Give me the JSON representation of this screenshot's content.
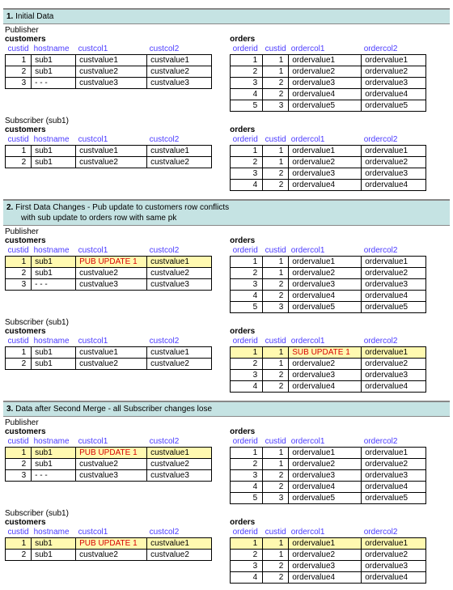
{
  "headers": {
    "s1": {
      "num": "1.",
      "title": "Initial Data",
      "sub": ""
    },
    "s2": {
      "num": "2.",
      "title": "First Data Changes - Pub update to customers row conflicts",
      "sub": "with sub update to orders row with same pk"
    },
    "s3": {
      "num": "3.",
      "title": "Data after Second Merge - all Subscriber changes lose",
      "sub": ""
    }
  },
  "hosts": {
    "pub": "Publisher",
    "sub": "Subscriber (sub1)"
  },
  "tblTitles": {
    "cust": "customers",
    "ord": "orders"
  },
  "custCols": [
    "custid",
    "hostname",
    "custcol1",
    "custcol2"
  ],
  "ordCols": [
    "orderid",
    "custid",
    "ordercol1",
    "ordercol2"
  ],
  "section1": {
    "pub": {
      "cust": [
        {
          "r": [
            "1",
            "sub1",
            "custvalue1",
            "custvalue1"
          ]
        },
        {
          "r": [
            "2",
            "sub1",
            "custvalue2",
            "custvalue2"
          ]
        },
        {
          "r": [
            "3",
            "- - -",
            "custvalue3",
            "custvalue3"
          ]
        }
      ],
      "ord": [
        {
          "r": [
            "1",
            "1",
            "ordervalue1",
            "ordervalue1"
          ]
        },
        {
          "r": [
            "2",
            "1",
            "ordervalue2",
            "ordervalue2"
          ]
        },
        {
          "r": [
            "3",
            "2",
            "ordervalue3",
            "ordervalue3"
          ]
        },
        {
          "r": [
            "4",
            "2",
            "ordervalue4",
            "ordervalue4"
          ]
        },
        {
          "r": [
            "5",
            "3",
            "ordervalue5",
            "ordervalue5"
          ]
        }
      ]
    },
    "sub": {
      "cust": [
        {
          "r": [
            "1",
            "sub1",
            "custvalue1",
            "custvalue1"
          ]
        },
        {
          "r": [
            "2",
            "sub1",
            "custvalue2",
            "custvalue2"
          ]
        }
      ],
      "ord": [
        {
          "r": [
            "1",
            "1",
            "ordervalue1",
            "ordervalue1"
          ]
        },
        {
          "r": [
            "2",
            "1",
            "ordervalue2",
            "ordervalue2"
          ]
        },
        {
          "r": [
            "3",
            "2",
            "ordervalue3",
            "ordervalue3"
          ]
        },
        {
          "r": [
            "4",
            "2",
            "ordervalue4",
            "ordervalue4"
          ]
        }
      ]
    }
  },
  "section2": {
    "pub": {
      "cust": [
        {
          "r": [
            "1",
            "sub1",
            "PUB UPDATE 1",
            "custvalue1"
          ],
          "hl": [
            0,
            1,
            3
          ],
          "upd": [
            2
          ]
        },
        {
          "r": [
            "2",
            "sub1",
            "custvalue2",
            "custvalue2"
          ]
        },
        {
          "r": [
            "3",
            "- - -",
            "custvalue3",
            "custvalue3"
          ]
        }
      ],
      "ord": [
        {
          "r": [
            "1",
            "1",
            "ordervalue1",
            "ordervalue1"
          ]
        },
        {
          "r": [
            "2",
            "1",
            "ordervalue2",
            "ordervalue2"
          ]
        },
        {
          "r": [
            "3",
            "2",
            "ordervalue3",
            "ordervalue3"
          ]
        },
        {
          "r": [
            "4",
            "2",
            "ordervalue4",
            "ordervalue4"
          ]
        },
        {
          "r": [
            "5",
            "3",
            "ordervalue5",
            "ordervalue5"
          ]
        }
      ]
    },
    "sub": {
      "cust": [
        {
          "r": [
            "1",
            "sub1",
            "custvalue1",
            "custvalue1"
          ]
        },
        {
          "r": [
            "2",
            "sub1",
            "custvalue2",
            "custvalue2"
          ]
        }
      ],
      "ord": [
        {
          "r": [
            "1",
            "1",
            "SUB UPDATE 1",
            "ordervalue1"
          ],
          "hl": [
            0,
            1,
            3
          ],
          "upd": [
            2
          ]
        },
        {
          "r": [
            "2",
            "1",
            "ordervalue2",
            "ordervalue2"
          ]
        },
        {
          "r": [
            "3",
            "2",
            "ordervalue3",
            "ordervalue3"
          ]
        },
        {
          "r": [
            "4",
            "2",
            "ordervalue4",
            "ordervalue4"
          ]
        }
      ]
    }
  },
  "section3": {
    "pub": {
      "cust": [
        {
          "r": [
            "1",
            "sub1",
            "PUB UPDATE 1",
            "custvalue1"
          ],
          "hl": [
            0,
            1,
            3
          ],
          "upd": [
            2
          ]
        },
        {
          "r": [
            "2",
            "sub1",
            "custvalue2",
            "custvalue2"
          ]
        },
        {
          "r": [
            "3",
            "- - -",
            "custvalue3",
            "custvalue3"
          ]
        }
      ],
      "ord": [
        {
          "r": [
            "1",
            "1",
            "ordervalue1",
            "ordervalue1"
          ]
        },
        {
          "r": [
            "2",
            "1",
            "ordervalue2",
            "ordervalue2"
          ]
        },
        {
          "r": [
            "3",
            "2",
            "ordervalue3",
            "ordervalue3"
          ]
        },
        {
          "r": [
            "4",
            "2",
            "ordervalue4",
            "ordervalue4"
          ]
        },
        {
          "r": [
            "5",
            "3",
            "ordervalue5",
            "ordervalue5"
          ]
        }
      ]
    },
    "sub": {
      "cust": [
        {
          "r": [
            "1",
            "sub1",
            "PUB UPDATE 1",
            "custvalue1"
          ],
          "hl": [
            0,
            1,
            3
          ],
          "upd": [
            2
          ]
        },
        {
          "r": [
            "2",
            "sub1",
            "custvalue2",
            "custvalue2"
          ]
        }
      ],
      "ord": [
        {
          "r": [
            "1",
            "1",
            "ordervalue1",
            "ordervalue1"
          ],
          "hl": [
            0,
            1,
            2,
            3
          ]
        },
        {
          "r": [
            "2",
            "1",
            "ordervalue2",
            "ordervalue2"
          ]
        },
        {
          "r": [
            "3",
            "2",
            "ordervalue3",
            "ordervalue3"
          ]
        },
        {
          "r": [
            "4",
            "2",
            "ordervalue4",
            "ordervalue4"
          ]
        }
      ]
    }
  }
}
